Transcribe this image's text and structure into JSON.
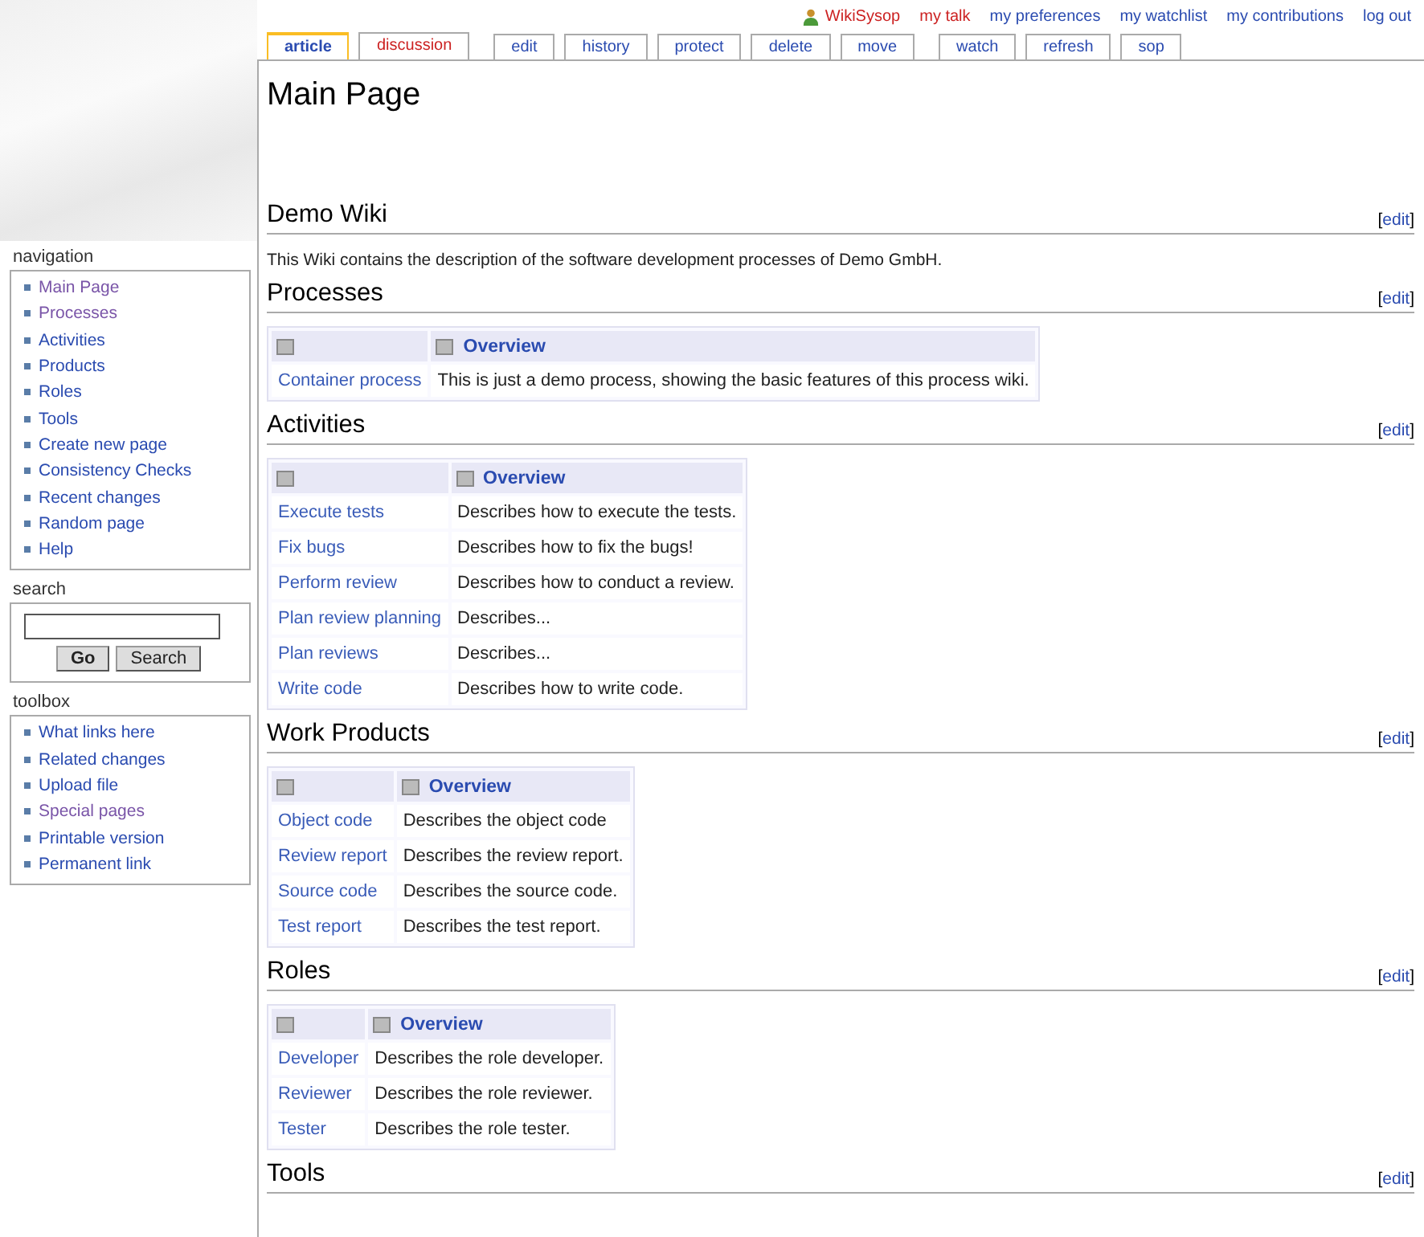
{
  "personal_links": [
    {
      "label": "WikiSysop",
      "kind": "user",
      "new": true
    },
    {
      "label": "my talk",
      "kind": "link",
      "new": true
    },
    {
      "label": "my preferences",
      "kind": "link",
      "new": false
    },
    {
      "label": "my watchlist",
      "kind": "link",
      "new": false
    },
    {
      "label": "my contributions",
      "kind": "link",
      "new": false
    },
    {
      "label": "log out",
      "kind": "link",
      "new": false
    }
  ],
  "tab_groups": [
    [
      {
        "label": "article",
        "selected": true,
        "new": false
      },
      {
        "label": "discussion",
        "selected": false,
        "new": true
      }
    ],
    [
      {
        "label": "edit",
        "selected": false,
        "new": false
      },
      {
        "label": "history",
        "selected": false,
        "new": false
      },
      {
        "label": "protect",
        "selected": false,
        "new": false
      },
      {
        "label": "delete",
        "selected": false,
        "new": false
      },
      {
        "label": "move",
        "selected": false,
        "new": false
      }
    ],
    [
      {
        "label": "watch",
        "selected": false,
        "new": false
      },
      {
        "label": "refresh",
        "selected": false,
        "new": false
      },
      {
        "label": "sop",
        "selected": false,
        "new": false
      }
    ]
  ],
  "page_title": "Main Page",
  "sidebar": {
    "portlets": [
      {
        "kind": "links",
        "title": "navigation",
        "items": [
          {
            "label": "Main Page",
            "visited": true
          },
          {
            "label": "Processes",
            "visited": true
          },
          {
            "label": "Activities",
            "visited": false
          },
          {
            "label": "Products",
            "visited": false
          },
          {
            "label": "Roles",
            "visited": false
          },
          {
            "label": "Tools",
            "visited": false
          },
          {
            "label": "Create new page",
            "visited": false
          },
          {
            "label": "Consistency Checks",
            "visited": false
          },
          {
            "label": "Recent changes",
            "visited": false
          },
          {
            "label": "Random page",
            "visited": false
          },
          {
            "label": "Help",
            "visited": false
          }
        ]
      },
      {
        "kind": "search",
        "title": "search",
        "buttons": [
          "Go",
          "Search"
        ]
      },
      {
        "kind": "links",
        "title": "toolbox",
        "items": [
          {
            "label": "What links here",
            "visited": false
          },
          {
            "label": "Related changes",
            "visited": false
          },
          {
            "label": "Upload file",
            "visited": false
          },
          {
            "label": "Special pages",
            "visited": true
          },
          {
            "label": "Printable version",
            "visited": false
          },
          {
            "label": "Permanent link",
            "visited": false
          }
        ]
      }
    ]
  },
  "sections": [
    {
      "heading": "Demo Wiki",
      "edit": {
        "open": "[",
        "label": "edit",
        "close": "]"
      },
      "paragraph": "This Wiki contains the description of the software development processes of Demo GmbH."
    },
    {
      "heading": "Processes",
      "edit": {
        "open": "[",
        "label": "edit",
        "close": "]"
      },
      "table": {
        "column_2": "Overview",
        "rows": [
          [
            "Container process",
            "This is just a demo process, showing the basic features of this process wiki."
          ]
        ]
      }
    },
    {
      "heading": "Activities",
      "edit": {
        "open": "[",
        "label": "edit",
        "close": "]"
      },
      "table": {
        "column_2": "Overview",
        "rows": [
          [
            "Execute tests",
            "Describes how to execute the tests."
          ],
          [
            "Fix bugs",
            "Describes how to fix the bugs!"
          ],
          [
            "Perform review",
            "Describes how to conduct a review."
          ],
          [
            "Plan review planning",
            "Describes..."
          ],
          [
            "Plan reviews",
            "Describes..."
          ],
          [
            "Write code",
            "Describes how to write code."
          ]
        ]
      }
    },
    {
      "heading": "Work Products",
      "edit": {
        "open": "[",
        "label": "edit",
        "close": "]"
      },
      "table": {
        "column_2": "Overview",
        "rows": [
          [
            "Object code",
            "Describes the object code"
          ],
          [
            "Review report",
            "Describes the review report."
          ],
          [
            "Source code",
            "Describes the source code."
          ],
          [
            "Test report",
            "Describes the test report."
          ]
        ]
      }
    },
    {
      "heading": "Roles",
      "edit": {
        "open": "[",
        "label": "edit",
        "close": "]"
      },
      "table": {
        "column_2": "Overview",
        "rows": [
          [
            "Developer",
            "Describes the role developer."
          ],
          [
            "Reviewer",
            "Describes the role reviewer."
          ],
          [
            "Tester",
            "Describes the role tester."
          ]
        ]
      }
    },
    {
      "heading": "Tools",
      "edit": {
        "open": "[",
        "label": "edit",
        "close": "]"
      }
    }
  ]
}
